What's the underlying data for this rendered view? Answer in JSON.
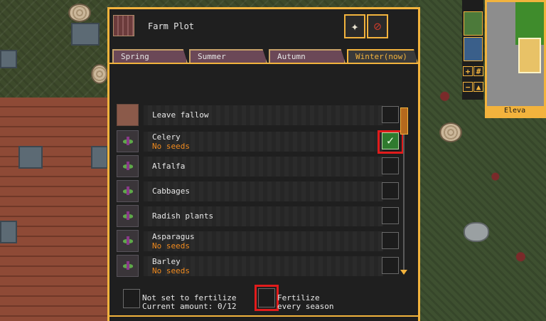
{
  "panel": {
    "title": "Farm Plot",
    "season_tabs": [
      "Spring",
      "Summer",
      "Autumn",
      "Winter(now)"
    ],
    "active_tab": "Winter(now)"
  },
  "crops": [
    {
      "name": "Leave fallow",
      "status": "",
      "checked": false,
      "icon": "fallow-soil-icon"
    },
    {
      "name": "Celery",
      "status": "No seeds",
      "checked": true,
      "icon": "sprout-icon"
    },
    {
      "name": "Alfalfa",
      "status": "",
      "checked": false,
      "icon": "sprout-icon"
    },
    {
      "name": "Cabbages",
      "status": "",
      "checked": false,
      "icon": "sprout-icon"
    },
    {
      "name": "Radish plants",
      "status": "",
      "checked": false,
      "icon": "sprout-icon"
    },
    {
      "name": "Asparagus",
      "status": "No seeds",
      "checked": false,
      "icon": "sprout-icon"
    },
    {
      "name": "Barley",
      "status": "No seeds",
      "checked": false,
      "icon": "sprout-icon"
    }
  ],
  "fertilize": {
    "left_line1": "Not set to fertilize",
    "left_line2": "Current amount: 0/12",
    "right_line1": "Fertilize",
    "right_line2": "every season"
  },
  "checkmark_glyph": "✓",
  "minimap": {
    "label": "Eleva"
  },
  "colors": {
    "accent": "#f2b33d",
    "warning": "#f08a1e",
    "checked": "#2f7a2e",
    "highlight": "#e11b1b"
  }
}
